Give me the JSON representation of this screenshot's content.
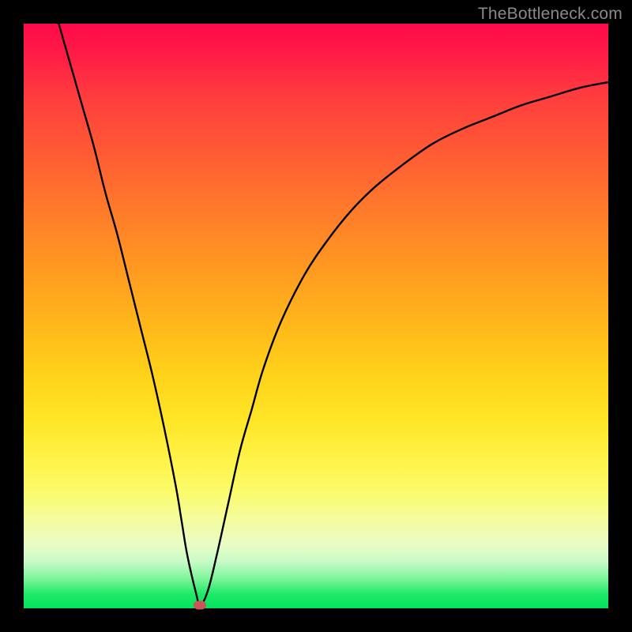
{
  "watermark": "TheBottleneck.com",
  "chart_data": {
    "type": "line",
    "title": "",
    "xlabel": "",
    "ylabel": "",
    "xlim": [
      0,
      100
    ],
    "ylim": [
      0,
      100
    ],
    "series": [
      {
        "name": "bottleneck-curve",
        "x": [
          6,
          8,
          10,
          12,
          14,
          16,
          18,
          20,
          22,
          24,
          26,
          27,
          28,
          29.5,
          30.2,
          31.5,
          33,
          35,
          37,
          39,
          41,
          44,
          48,
          52,
          56,
          60,
          65,
          70,
          75,
          80,
          85,
          90,
          95,
          100
        ],
        "values": [
          100,
          93,
          86,
          79,
          71,
          64,
          56,
          48,
          40,
          31,
          21,
          15,
          9,
          2.5,
          0.5,
          3,
          9,
          18,
          27,
          34,
          41,
          49,
          57,
          63,
          68,
          72,
          76,
          79.5,
          82,
          84,
          86,
          87.5,
          89,
          90
        ]
      }
    ],
    "marker": {
      "x": 30.2,
      "y": 0.5,
      "color": "#cb5658"
    },
    "gradient_stops": [
      {
        "pos": 0,
        "color": "#ff0a4a"
      },
      {
        "pos": 50,
        "color": "#ffb91a"
      },
      {
        "pos": 80,
        "color": "#fbfb6a"
      },
      {
        "pos": 100,
        "color": "#00e45c"
      }
    ]
  }
}
